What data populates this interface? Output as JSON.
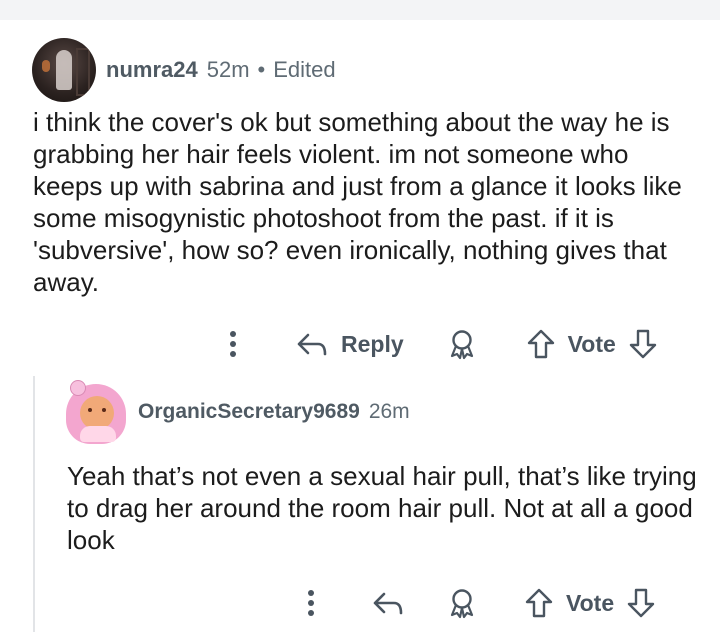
{
  "comments": [
    {
      "username": "numra24",
      "time": "52m",
      "separator": "•",
      "edited": "Edited",
      "body": "i think the cover's ok but something about the way he is grabbing her hair feels violent. im not someone who keeps up with sabrina and just from a glance it looks like some misogynistic photoshoot from the past. if it is 'subversive', how so? even ironically, nothing gives that away.",
      "actions": {
        "reply_label": "Reply",
        "vote_label": "Vote"
      },
      "avatar_icon": "user-avatar-photo"
    },
    {
      "username": "OrganicSecretary9689",
      "time": "26m",
      "body": "Yeah that’s not even a sexual hair pull, that’s like trying to drag her around the room hair pull. Not at all a good look",
      "actions": {
        "vote_label": "Vote"
      },
      "avatar_icon": "snoo-avatar-pink-hair"
    }
  ],
  "colors": {
    "meta": "#5f6b74",
    "icons": "#4a5560",
    "thread_line": "#e2e4e7"
  },
  "icons": [
    "more-vertical-icon",
    "reply-arrow-icon",
    "award-icon",
    "upvote-arrow-icon",
    "downvote-arrow-icon"
  ]
}
